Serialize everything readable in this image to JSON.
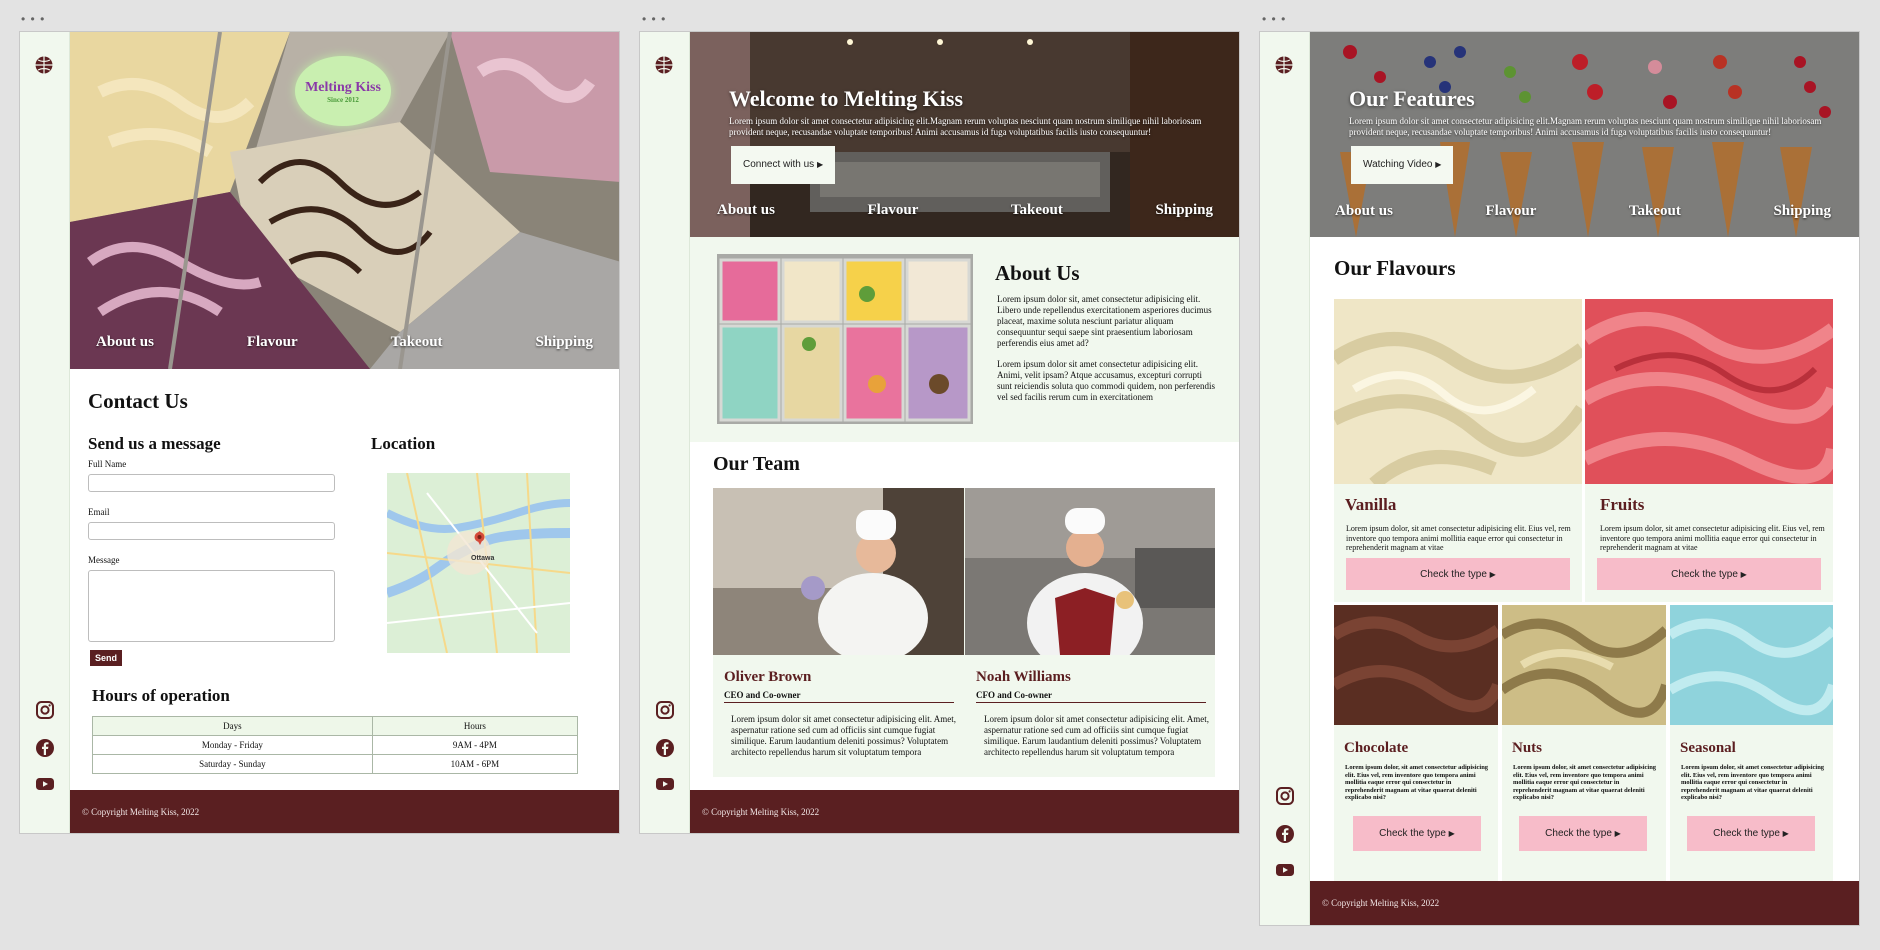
{
  "brand": {
    "logo_name": "Melting Kiss",
    "logo_sub": "Since 2012",
    "maroon": "#5a1f21",
    "mint": "#f1f8ee",
    "pink": "#f7bcc9"
  },
  "nav": [
    "About us",
    "Flavour",
    "Takeout",
    "Shipping"
  ],
  "footer": "© Copyright Melting Kiss, 2022",
  "contact_page": {
    "title": "Contact Us",
    "form_heading": "Send us a message",
    "full_name_label": "Full Name",
    "email_label": "Email",
    "message_label": "Message",
    "send_label": "Send",
    "location_heading": "Location",
    "map_city": "Ottawa",
    "hours_heading": "Hours of operation",
    "hours_headers": [
      "Days",
      "Hours"
    ],
    "hours_rows": [
      [
        "Monday - Friday",
        "9AM - 4PM"
      ],
      [
        "Saturday - Sunday",
        "10AM - 6PM"
      ]
    ]
  },
  "home_page": {
    "hero_title": "Welcome to Melting Kiss",
    "hero_text": "Lorem ipsum dolor sit amet consectetur adipisicing elit.Magnam rerum voluptas nesciunt quam nostrum similique nihil laboriosam provident neque, recusandae voluptate temporibus! Animi accusamus id fuga voluptatibus facilis iusto consequuntur!",
    "hero_button": "Connect with us",
    "about_title": "About Us",
    "about_p1": "Lorem ipsum dolor sit, amet consectetur adipisicing elit. Libero unde repellendus exercitationem asperiores ducimus placeat, maxime soluta nesciunt pariatur aliquam consequuntur sequi saepe sint praesentium laboriosam perferendis eius amet ad?",
    "about_p2": "Lorem ipsum dolor sit amet consectetur adipisicing elit. Animi, velit ipsam? Atque accusamus, excepturi corrupti sunt reiciendis soluta quo commodi quidem, non perferendis vel sed facilis rerum cum in exercitationem",
    "team_title": "Our Team",
    "team": [
      {
        "name": "Oliver Brown",
        "role": "CEO and Co-owner",
        "bio": "Lorem ipsum dolor sit amet consectetur adipisicing elit. Amet, aspernatur ratione sed cum ad officiis sint cumque fugiat similique. Earum laudantium deleniti possimus? Voluptatem architecto repellendus harum sit voluptatum tempora"
      },
      {
        "name": "Noah Williams",
        "role": "CFO and Co-owner",
        "bio": "Lorem ipsum dolor sit amet consectetur adipisicing elit. Amet, aspernatur ratione sed cum ad officiis sint cumque fugiat similique. Earum laudantium deleniti possimus? Voluptatem architecto repellendus harum sit voluptatum tempora"
      }
    ]
  },
  "features_page": {
    "hero_title": "Our Features",
    "hero_text": "Lorem ipsum dolor sit amet consectetur adipisicing elit.Magnam rerum voluptas nesciunt quam nostrum similique nihil laboriosam provident neque, recusandae voluptate temporibus! Animi accusamus id fuga voluptatibus facilis iusto consequuntur!",
    "hero_button": "Watching Video",
    "flavours_title": "Our Flavours",
    "button_label": "Check the type",
    "big_cards": [
      {
        "name": "Vanilla",
        "text": "Lorem ipsum dolor, sit amet consectetur adipisicing elit. Eius vel, rem inventore quo tempora animi mollitia eaque error qui consectetur in reprehenderit magnam at vitae"
      },
      {
        "name": "Fruits",
        "text": "Lorem ipsum dolor, sit amet consectetur adipisicing elit. Eius vel, rem inventore quo tempora animi mollitia eaque error qui consectetur in reprehenderit magnam at vitae"
      }
    ],
    "small_cards": [
      {
        "name": "Chocolate",
        "text": "Lorem ipsum dolor, sit amet consectetur adipisicing elit. Eius vel, rem inventore quo tempora animi mollitia eaque error qui consectetur in reprehenderit magnam at vitae quaerat deleniti explicabo nisi?"
      },
      {
        "name": "Nuts",
        "text": "Lorem ipsum dolor, sit amet consectetur adipisicing elit. Eius vel, rem inventore quo tempora animi mollitia eaque error qui consectetur in reprehenderit magnam at vitae quaerat deleniti explicabo nisi?"
      },
      {
        "name": "Seasonal",
        "text": "Lorem ipsum dolor, sit amet consectetur adipisicing elit. Eius vel, rem inventore quo tempora animi mollitia eaque error qui consectetur in reprehenderit magnam at vitae quaerat deleniti explicabo nisi?"
      }
    ]
  }
}
